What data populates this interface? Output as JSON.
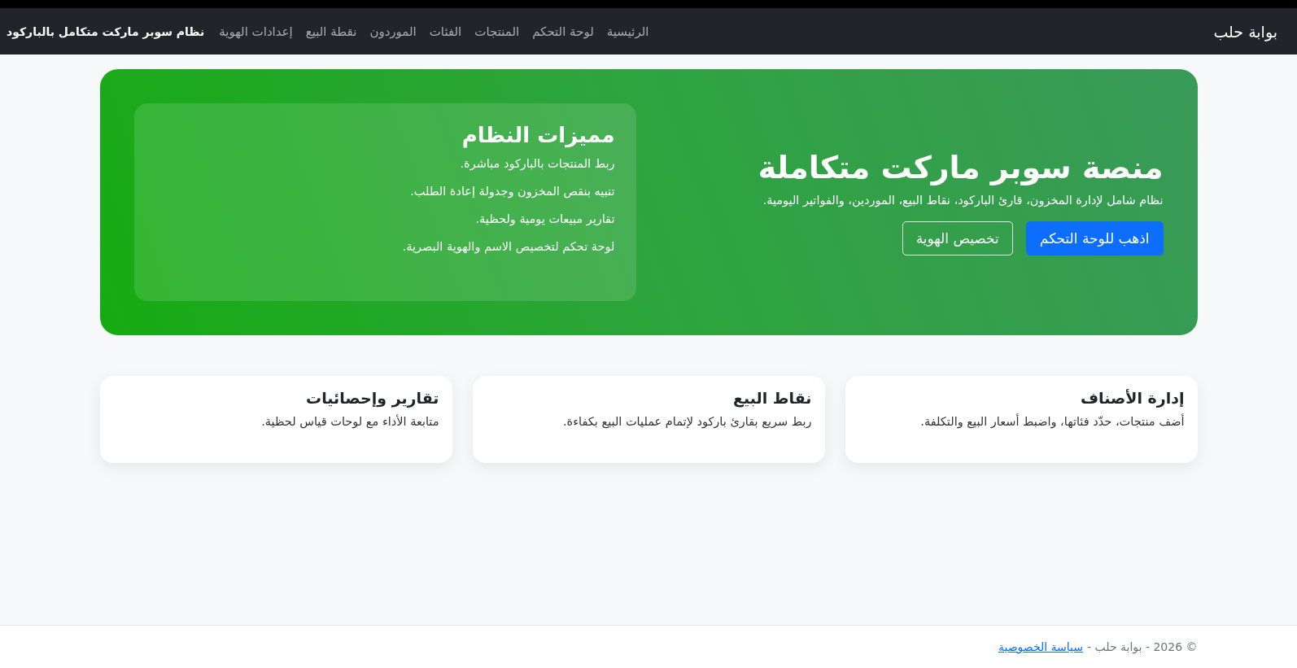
{
  "navbar": {
    "brand": "بوابة حلب",
    "links": [
      "الرئيسية",
      "لوحة التحكم",
      "المنتجات",
      "الفئات",
      "الموردون",
      "نقطة البيع",
      "إعدادات الهوية"
    ],
    "tagline": "نظام سوبر ماركت متكامل بالباركود"
  },
  "hero": {
    "title": "منصة سوبر ماركت متكاملة",
    "subtitle": "نظام شامل لإدارة المخزون، قارئ الباركود، نقاط البيع، الموردين، والفواتير اليومية.",
    "buttons": [
      {
        "label": "اذهب للوحة التحكم",
        "kind": "primary"
      },
      {
        "label": "تخصيص الهوية",
        "kind": "outline"
      }
    ],
    "features": {
      "title": "مميزات النظام",
      "items": [
        "ربط المنتجات بالباركود مباشرة.",
        "تنبيه بنقص المخزون وجدولة إعادة الطلب.",
        "تقارير مبيعات يومية ولحظية.",
        "لوحة تحكم لتخصيص الاسم والهوية البصرية."
      ]
    }
  },
  "cards": [
    {
      "title": "إدارة الأصناف",
      "text": "أضف منتجات، حدّد فئاتها، واضبط أسعار البيع والتكلفة."
    },
    {
      "title": "نقاط البيع",
      "text": "ربط سريع بقارئ باركود لإتمام عمليات البيع بكفاءة."
    },
    {
      "title": "تقارير وإحصائيات",
      "text": "متابعة الأداء مع لوحات قياس لحظية."
    }
  ],
  "footer": {
    "text": "© 2026 - بوابة حلب -",
    "link": "سياسة الخصوصية"
  }
}
